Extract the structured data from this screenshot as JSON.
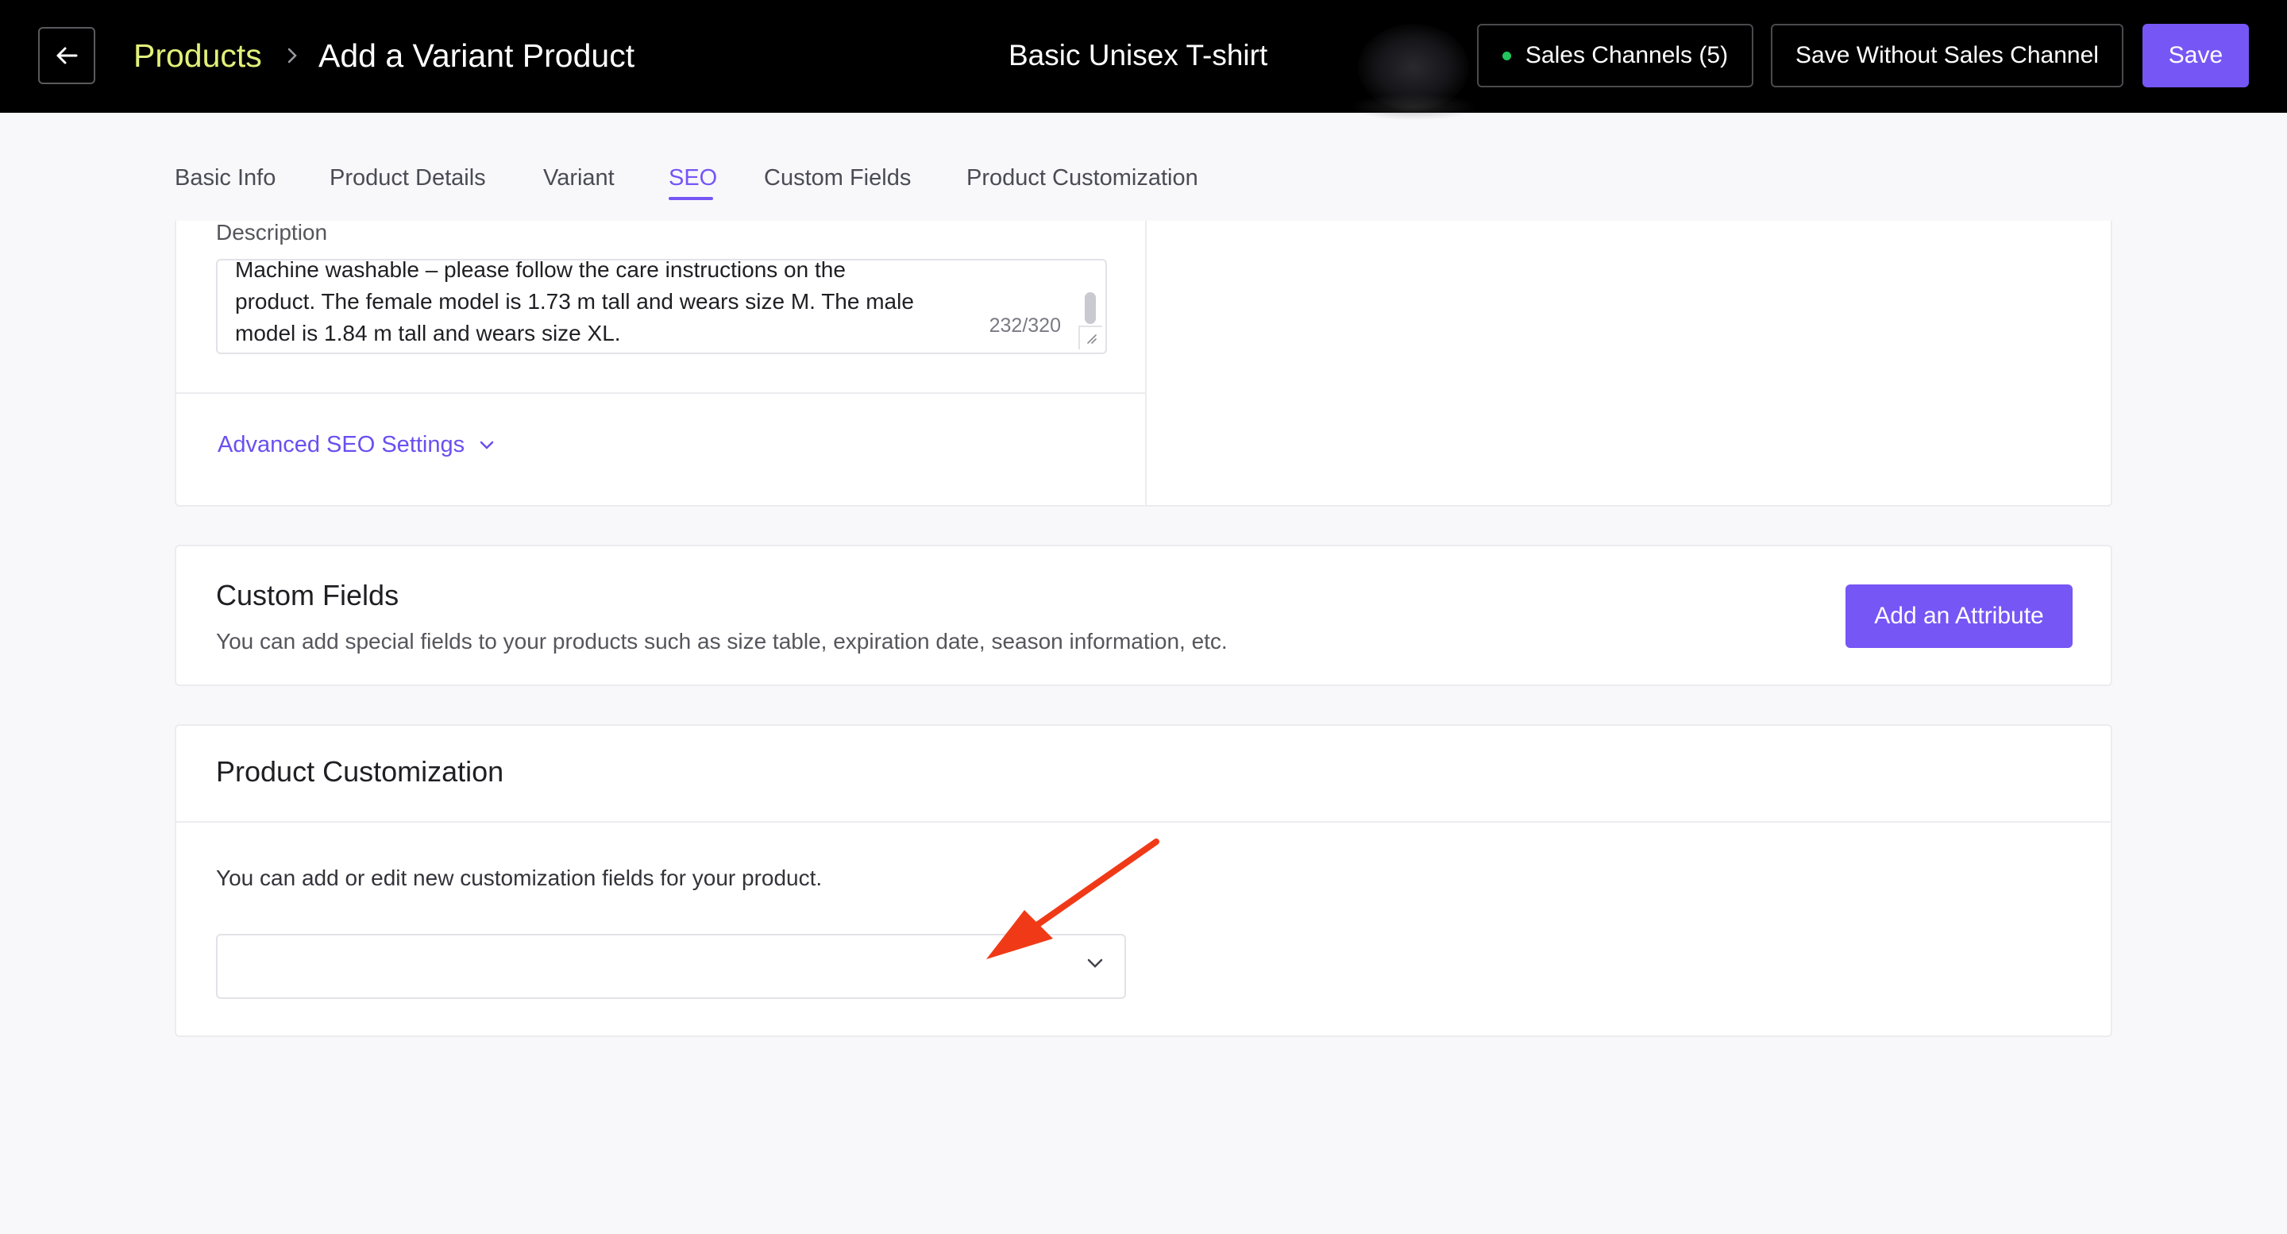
{
  "header": {
    "breadcrumb_root": "Products",
    "breadcrumb_current": "Add a Variant Product",
    "product_name": "Basic Unisex T-shirt",
    "sales_channels_label": "Sales Channels (5)",
    "save_without_label": "Save Without Sales Channel",
    "save_label": "Save",
    "colors": {
      "background": "#000000",
      "accent": "#7656f5",
      "breadcrumb": "#e2f07a",
      "status_dot": "#22c55e"
    }
  },
  "tabs": [
    {
      "label": "Basic Info",
      "active": false
    },
    {
      "label": "Product Details",
      "active": false
    },
    {
      "label": "Variant",
      "active": false
    },
    {
      "label": "SEO",
      "active": true
    },
    {
      "label": "Custom Fields",
      "active": false
    },
    {
      "label": "Product Customization",
      "active": false
    }
  ],
  "seo": {
    "description_label": "Description",
    "description_lines": [
      "Machine washable – please follow the care instructions on the",
      "product. The female model is 1.73 m tall and wears size M. The male",
      "model is 1.84 m tall and wears size XL."
    ],
    "char_count": "232/320",
    "advanced_label": "Advanced SEO Settings"
  },
  "custom_fields": {
    "title": "Custom Fields",
    "description": "You can add special fields to your products such as size table, expiration date, season information, etc.",
    "add_button": "Add an Attribute"
  },
  "product_customization": {
    "title": "Product Customization",
    "description": "You can add or edit new customization fields for your product.",
    "select_value": ""
  },
  "annotation": {
    "color": "#f03a17",
    "icon": "red-arrow-icon"
  }
}
